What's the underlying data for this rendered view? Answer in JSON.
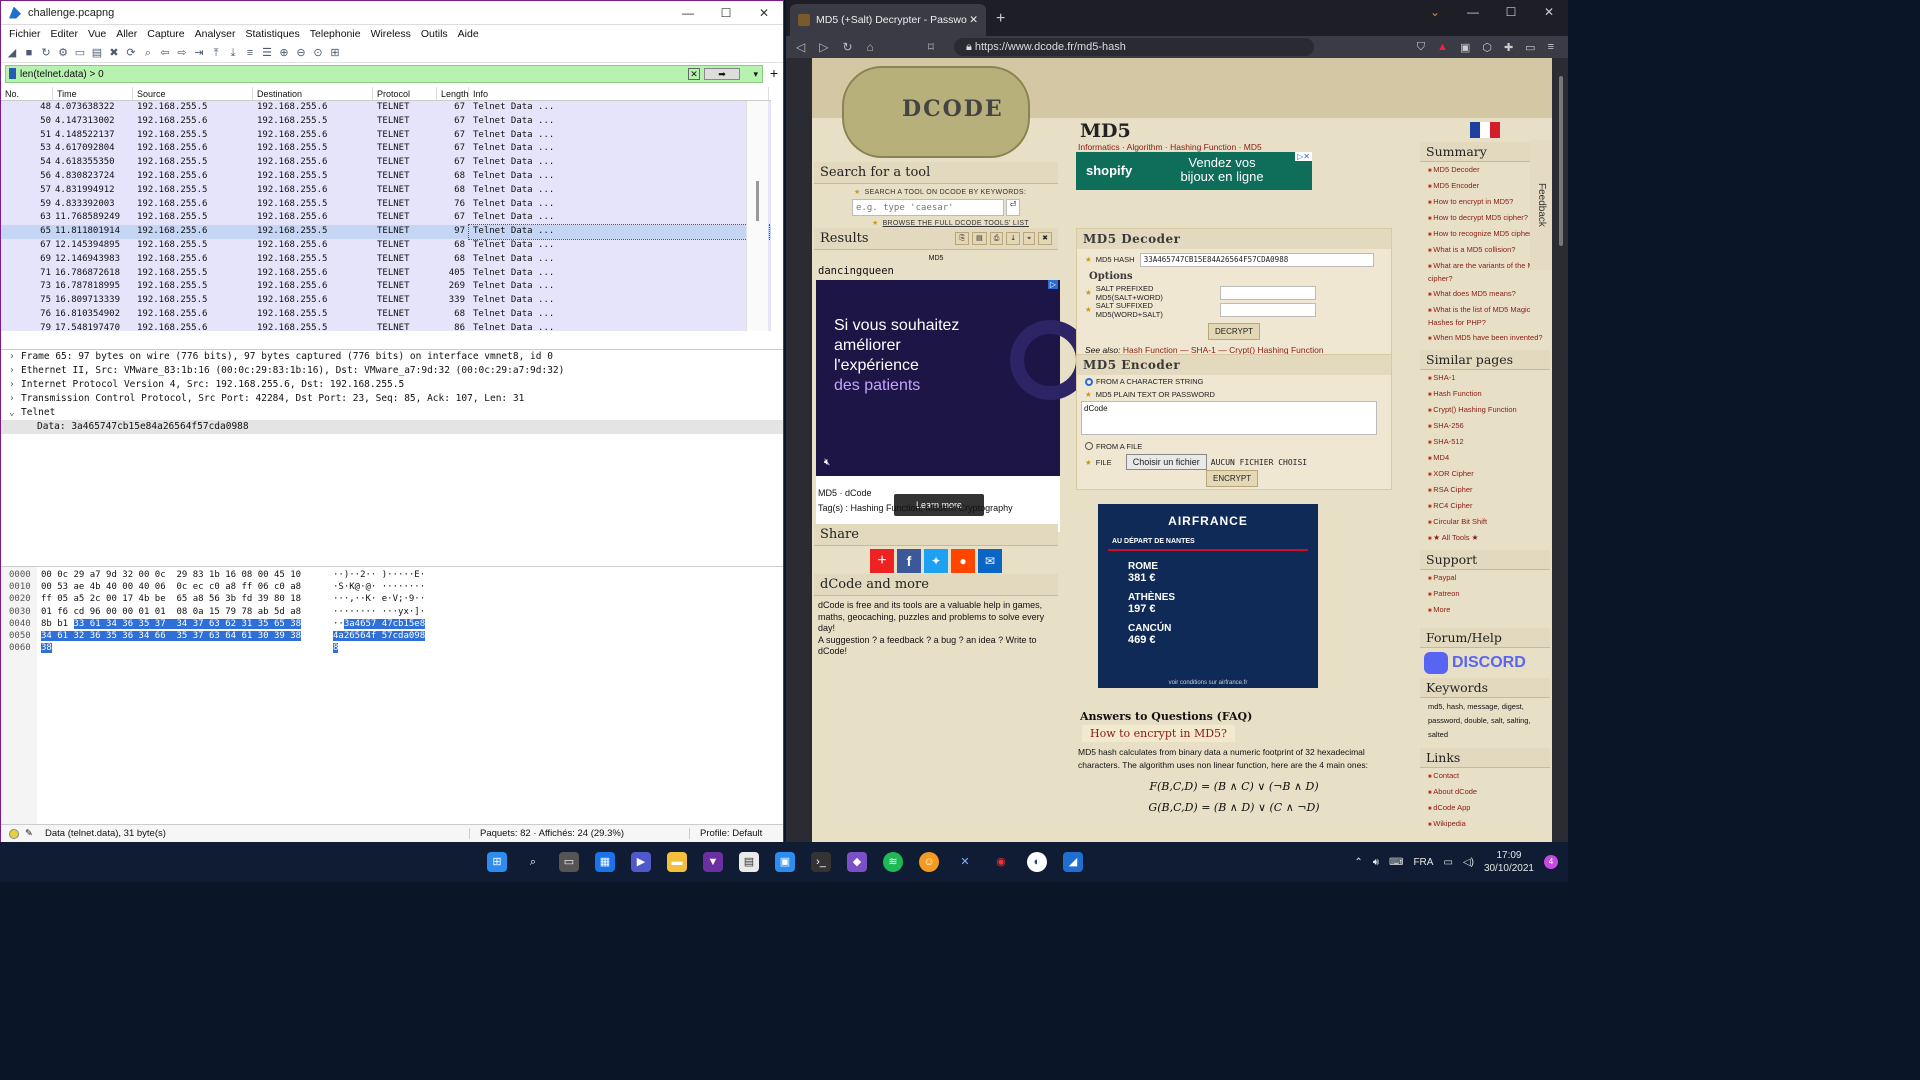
{
  "wireshark": {
    "title": "challenge.pcapng",
    "menu": [
      "Fichier",
      "Editer",
      "Vue",
      "Aller",
      "Capture",
      "Analyser",
      "Statistiques",
      "Telephonie",
      "Wireless",
      "Outils",
      "Aide"
    ],
    "filter": "len(telnet.data) > 0",
    "columns": [
      "No.",
      "Time",
      "Source",
      "Destination",
      "Protocol",
      "Length",
      "Info"
    ],
    "packets": [
      [
        "48",
        "4.073638322",
        "192.168.255.5",
        "192.168.255.6",
        "TELNET",
        "67",
        "Telnet Data ..."
      ],
      [
        "50",
        "4.147313002",
        "192.168.255.6",
        "192.168.255.5",
        "TELNET",
        "67",
        "Telnet Data ..."
      ],
      [
        "51",
        "4.148522137",
        "192.168.255.5",
        "192.168.255.6",
        "TELNET",
        "67",
        "Telnet Data ..."
      ],
      [
        "53",
        "4.617092804",
        "192.168.255.6",
        "192.168.255.5",
        "TELNET",
        "67",
        "Telnet Data ..."
      ],
      [
        "54",
        "4.618355350",
        "192.168.255.5",
        "192.168.255.6",
        "TELNET",
        "67",
        "Telnet Data ..."
      ],
      [
        "56",
        "4.830823724",
        "192.168.255.6",
        "192.168.255.5",
        "TELNET",
        "68",
        "Telnet Data ..."
      ],
      [
        "57",
        "4.831994912",
        "192.168.255.5",
        "192.168.255.6",
        "TELNET",
        "68",
        "Telnet Data ..."
      ],
      [
        "59",
        "4.833392003",
        "192.168.255.6",
        "192.168.255.5",
        "TELNET",
        "76",
        "Telnet Data ..."
      ],
      [
        "63",
        "11.768589249",
        "192.168.255.5",
        "192.168.255.6",
        "TELNET",
        "67",
        "Telnet Data ..."
      ],
      [
        "65",
        "11.811801914",
        "192.168.255.6",
        "192.168.255.5",
        "TELNET",
        "97",
        "Telnet Data ..."
      ],
      [
        "67",
        "12.145394895",
        "192.168.255.5",
        "192.168.255.6",
        "TELNET",
        "68",
        "Telnet Data ..."
      ],
      [
        "69",
        "12.146943983",
        "192.168.255.6",
        "192.168.255.5",
        "TELNET",
        "68",
        "Telnet Data ..."
      ],
      [
        "71",
        "16.786872618",
        "192.168.255.5",
        "192.168.255.6",
        "TELNET",
        "405",
        "Telnet Data ..."
      ],
      [
        "73",
        "16.787818995",
        "192.168.255.5",
        "192.168.255.6",
        "TELNET",
        "269",
        "Telnet Data ..."
      ],
      [
        "75",
        "16.809713339",
        "192.168.255.5",
        "192.168.255.6",
        "TELNET",
        "339",
        "Telnet Data ..."
      ],
      [
        "76",
        "16.810354902",
        "192.168.255.6",
        "192.168.255.5",
        "TELNET",
        "68",
        "Telnet Data ..."
      ],
      [
        "79",
        "17.548197470",
        "192.168.255.6",
        "192.168.255.5",
        "TELNET",
        "86",
        "Telnet Data ..."
      ]
    ],
    "details": [
      "Frame 65: 97 bytes on wire (776 bits), 97 bytes captured (776 bits) on interface vmnet8, id 0",
      "Ethernet II, Src: VMware_83:1b:16 (00:0c:29:83:1b:16), Dst: VMware_a7:9d:32 (00:0c:29:a7:9d:32)",
      "Internet Protocol Version 4, Src: 192.168.255.6, Dst: 192.168.255.5",
      "Transmission Control Protocol, Src Port: 42284, Dst Port: 23, Seq: 85, Ack: 107, Len: 31",
      "Telnet"
    ],
    "detail_sub": "Data: 3a465747cb15e84a26564f57cda0988",
    "hex": [
      {
        "off": "0000",
        "pre": "00 0c 29 a7 9d 32 00 0c  29 83 1b 16 08 00 45 10",
        "hl": "",
        "apre": "··)··2·· )·····E·",
        "ahl": ""
      },
      {
        "off": "0010",
        "pre": "00 53 ae 4b 40 00 40 06  0c ec c0 a8 ff 06 c0 a8",
        "hl": "",
        "apre": "·S·K@·@· ········",
        "ahl": ""
      },
      {
        "off": "0020",
        "pre": "ff 05 a5 2c 00 17 4b be  65 a8 56 3b fd 39 80 18",
        "hl": "",
        "apre": "···,··K· e·V;·9··",
        "ahl": ""
      },
      {
        "off": "0030",
        "pre": "01 f6 cd 96 00 00 01 01  08 0a 15 79 78 ab 5d a8",
        "hl": "",
        "apre": "········ ···yx·]·",
        "ahl": ""
      },
      {
        "off": "0040",
        "pre": "8b b1 ",
        "hl": "33 61 34 36 35 37  34 37 63 62 31 35 65 38",
        "apre": "··",
        "ahl": "3a4657 47cb15e8"
      },
      {
        "off": "0050",
        "pre": "",
        "hl": "34 61 32 36 35 36 34 66  35 37 63 64 61 30 39 38",
        "apre": "",
        "ahl": "4a26564f 57cda098"
      },
      {
        "off": "0060",
        "pre": "",
        "hl": "38",
        "apre": "",
        "ahl": "8"
      }
    ],
    "status_left": "Data (telnet.data), 31 byte(s)",
    "status_mid": "Paquets: 82 · Affichés: 24 (29.3%)",
    "status_right": "Profile: Default"
  },
  "browser": {
    "tab_title": "MD5 (+Salt) Decrypter - Passwo",
    "url": "https://www.dcode.fr/md5-hash",
    "logo_text": "DCODE",
    "search": {
      "title": "Search for a tool",
      "label": "SEARCH A TOOL ON DCODE BY KEYWORDS:",
      "placeholder": "e.g. type 'caesar'",
      "browse": "BROWSE THE FULL DCODE TOOLS' LIST"
    },
    "results": {
      "title": "Results",
      "type": "MD5",
      "value": "dancingqueen"
    },
    "ad1": {
      "line1": "Si vous souhaitez améliorer l'expérience",
      "line2": "des patients",
      "button": "Learn more"
    },
    "meta": {
      "crumb": "MD5 · dCode",
      "tags": "Tag(s) : Hashing Function, Modern Cryptography"
    },
    "share_title": "Share",
    "more_title": "dCode and more",
    "more_text": "dCode is free and its tools are a valuable help in games, maths, geocaching, puzzles and problems to solve every day!",
    "more_text2": "A suggestion ? a feedback ? a bug ? an idea ? Write to dCode!",
    "center": {
      "title": "MD5",
      "crumbs": "Informatics · Algorithm · Hashing Function · MD5",
      "shopify_brand": "shopify",
      "shopify_text": "Vendez vos bijoux en ligne",
      "decoder_title": "MD5 Decoder",
      "hash_label": "MD5 HASH",
      "hash_value": "33A465747CB15E84A26564F57CDA0988",
      "options": "Options",
      "salt_prefix": "SALT PREFIXED MD5(SALT+WORD)",
      "salt_suffix": "SALT SUFFIXED MD5(WORD+SALT)",
      "decrypt": "DECRYPT",
      "see_also_label": "See also:",
      "see_also": "Hash Function — SHA-1 — Crypt() Hashing Function",
      "encoder_title": "MD5 Encoder",
      "from_string": "FROM A CHARACTER STRING",
      "plain_label": "MD5 PLAIN TEXT OR PASSWORD",
      "plain_value": "dCode",
      "from_file": "FROM A FILE",
      "file_label": "FILE",
      "choose_file": "Choisir un fichier",
      "no_file": "AUCUN FICHIER CHOISI",
      "encrypt": "ENCRYPT",
      "ad2_brand": "AIRFRANCE",
      "ad2_from": "AU DÉPART DE NANTES",
      "ad2_dests": [
        {
          "city": "ROME",
          "price": "381 €"
        },
        {
          "city": "ATHÈNES",
          "price": "197 €"
        },
        {
          "city": "CANCÚN",
          "price": "469 €"
        }
      ],
      "ad2_footer": "voir conditions sur airfrance.fr",
      "faq_title": "Answers to Questions (FAQ)",
      "faq_q": "How to encrypt in MD5?",
      "faq_text": "MD5 hash calculates from binary data a numeric footprint of 32 hexadecimal characters. The algorithm uses non linear function, here are the 4 main ones:",
      "f1": "F(B,C,D) = (B ∧ C) ∨ (¬B ∧ D)",
      "f2": "G(B,C,D) = (B ∧ D) ∨ (C ∧ ¬D)"
    },
    "right": {
      "summary_title": "Summary",
      "summary": [
        "MD5 Decoder",
        "MD5 Encoder",
        "How to encrypt in MD5?",
        "How to decrypt MD5 cipher?",
        "How to recognize MD5 ciphertext?",
        "What is a MD5 collision?",
        "What are the variants of the MD5 cipher?",
        "What does MD5 means?",
        "What is the list of MD5 Magic Hashes for PHP?",
        "When MD5 have been invented?"
      ],
      "similar_title": "Similar pages",
      "similar": [
        "SHA-1",
        "Hash Function",
        "Crypt() Hashing Function",
        "SHA-256",
        "SHA-512",
        "MD4",
        "XOR Cipher",
        "RSA Cipher",
        "RC4 Cipher",
        "Circular Bit Shift",
        "★ All Tools ★"
      ],
      "support_title": "Support",
      "support": [
        "Paypal",
        "Patreon",
        "More"
      ],
      "forum_title": "Forum/Help",
      "discord": "DISCORD",
      "keywords_title": "Keywords",
      "keywords": "md5, hash, message, digest, password, double, salt, salting, salted",
      "links_title": "Links",
      "links": [
        "Contact",
        "About dCode",
        "dCode App",
        "Wikipedia"
      ],
      "feedback": "Feedback"
    }
  },
  "taskbar": {
    "lang": "FRA",
    "time": "17:09",
    "date": "30/10/2021",
    "notif": "4"
  }
}
